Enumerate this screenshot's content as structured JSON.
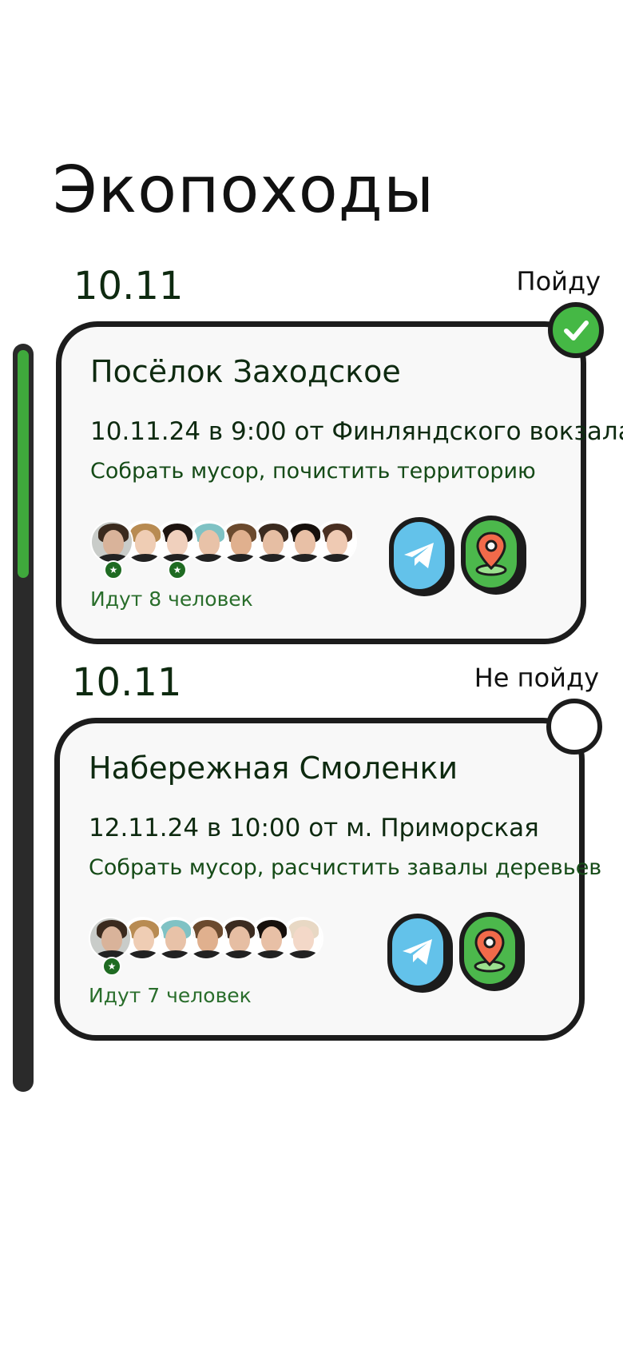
{
  "page": {
    "title": "Экопоходы"
  },
  "progress": {
    "fraction": 0.31
  },
  "events": [
    {
      "date": "10.11",
      "status": "Пойду",
      "checked": true,
      "title": "Посёлок Заходское",
      "when": "10.11.24 в 9:00 от Финляндского вокзала",
      "task": "Собрать мусор, почистить территорию",
      "going": "Идут 8 человек",
      "avatars": [
        {
          "skin": "#d9b39a",
          "hair": "#3a2a1e",
          "bg": "#c9ccc9",
          "star": true
        },
        {
          "skin": "#efcdb4",
          "hair": "#b88b52",
          "bg": "#ffffff",
          "star": false
        },
        {
          "skin": "#f0d0bd",
          "hair": "#1d1410",
          "bg": "#ffffff",
          "star": true
        },
        {
          "skin": "#e8c2a8",
          "hair": "#7fc2c4",
          "bg": "#ffffff",
          "star": false
        },
        {
          "skin": "#e0b08e",
          "hair": "#6b4a2e",
          "bg": "#ffffff",
          "star": false
        },
        {
          "skin": "#e6bea3",
          "hair": "#3b2b20",
          "bg": "#ffffff",
          "star": false
        },
        {
          "skin": "#e8c0a6",
          "hair": "#16100c",
          "bg": "#ffffff",
          "star": false
        },
        {
          "skin": "#efcab3",
          "hair": "#4a3022",
          "bg": "#ffffff",
          "star": false
        }
      ]
    },
    {
      "date": "10.11",
      "status": "Не пойду",
      "checked": false,
      "title": "Набережная Смоленки",
      "when": "12.11.24 в 10:00 от м. Приморская",
      "task": "Собрать мусор, расчистить завалы деревьев",
      "going": "Идут 7 человек",
      "avatars": [
        {
          "skin": "#d9b39a",
          "hair": "#3a2a1e",
          "bg": "#c9ccc9",
          "star": true
        },
        {
          "skin": "#efcdb4",
          "hair": "#b88b52",
          "bg": "#ffffff",
          "star": false
        },
        {
          "skin": "#e8c2a8",
          "hair": "#7fc2c4",
          "bg": "#ffffff",
          "star": false
        },
        {
          "skin": "#e0b08e",
          "hair": "#6b4a2e",
          "bg": "#ffffff",
          "star": false
        },
        {
          "skin": "#e6bea3",
          "hair": "#3b2b20",
          "bg": "#ffffff",
          "star": false
        },
        {
          "skin": "#e8c0a6",
          "hair": "#16100c",
          "bg": "#ffffff",
          "star": false
        },
        {
          "skin": "#f3d8c8",
          "hair": "#e8d8c4",
          "bg": "#ffffff",
          "star": false
        }
      ]
    }
  ],
  "icons": {
    "check": "check-icon",
    "telegram": "telegram-icon",
    "map": "map-pin-icon",
    "star": "star-icon"
  },
  "colors": {
    "accent": "#3fa83c",
    "telegram": "#63c2ea",
    "map_button": "#4cb84c",
    "badge": "#1f6b22"
  }
}
